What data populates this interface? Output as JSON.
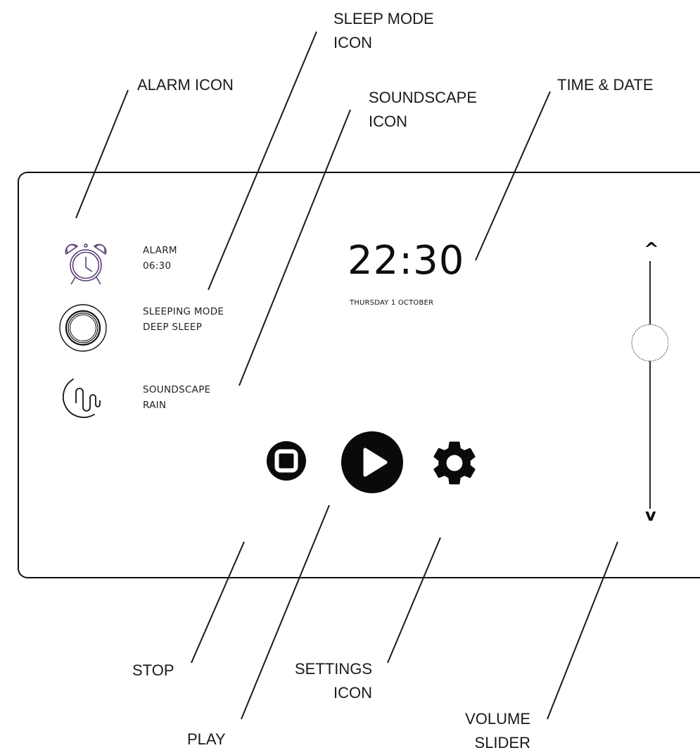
{
  "callouts": {
    "sleep_mode_icon": "SLEEP MODE\nICON",
    "alarm_icon": "ALARM ICON",
    "soundscape_icon": "SOUNDSCAPE\nICON",
    "time_date": "TIME & DATE",
    "stop": "STOP",
    "play": "PLAY",
    "settings_icon": "SETTINGS\nICON",
    "volume_slider": "VOLUME\nSLIDER"
  },
  "alarm": {
    "label": "ALARM",
    "value": "06:30"
  },
  "sleeping_mode": {
    "label": "SLEEPING MODE",
    "value": "DEEP SLEEP"
  },
  "soundscape": {
    "label": "SOUNDSCAPE",
    "value": "RAIN"
  },
  "clock": {
    "time": "22:30",
    "date": "THURSDAY 1 OCTOBER"
  },
  "volume": {
    "up_label": "^",
    "down_label": "v",
    "level": 0.67
  },
  "icons": {
    "alarm": "alarm-clock-icon",
    "sleep_mode": "ring-icon",
    "soundscape": "moon-wave-icon",
    "stop": "stop-icon",
    "play": "play-icon",
    "settings": "gear-icon"
  },
  "colors": {
    "alarm_icon": "#5a3f78",
    "ink": "#111111"
  }
}
